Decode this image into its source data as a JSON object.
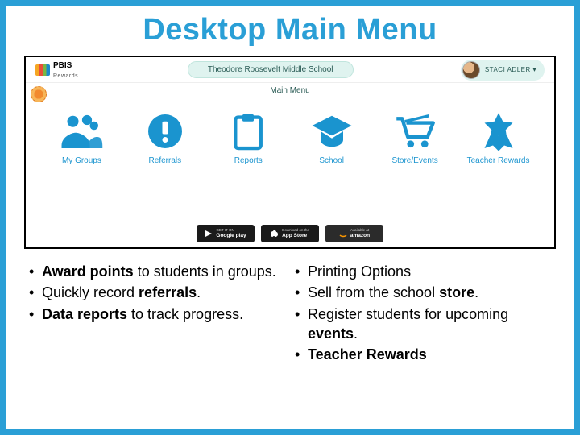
{
  "title": "Desktop Main Menu",
  "app": {
    "logo_text": "PBIS",
    "logo_sub": "Rewards.",
    "school_name": "Theodore Roosevelt Middle School",
    "user_name": "STACI ADLER ▾",
    "subhead": "Main Menu"
  },
  "tiles": [
    {
      "name": "my-groups",
      "label": "My Groups"
    },
    {
      "name": "referrals",
      "label": "Referrals"
    },
    {
      "name": "reports",
      "label": "Reports"
    },
    {
      "name": "school",
      "label": "School"
    },
    {
      "name": "store-events",
      "label": "Store/Events"
    },
    {
      "name": "teacher-rewards",
      "label": "Teacher Rewards"
    }
  ],
  "store_badges": {
    "google": {
      "line1": "GET IT ON",
      "line2": "Google play"
    },
    "apple": {
      "line1": "Download on the",
      "line2": "App Store"
    },
    "amazon": {
      "line1": "Available at",
      "line2": "amazon"
    }
  },
  "bullets_left": [
    {
      "pre_b": "Award points",
      "post": " to students in groups."
    },
    {
      "pre": "Quickly record ",
      "b": "referrals",
      "post": "."
    },
    {
      "b": "Data reports",
      "post": " to track progress."
    }
  ],
  "bullets_right": [
    {
      "post": "Printing Options"
    },
    {
      "pre": "Sell from the school ",
      "b": "store",
      "post": "."
    },
    {
      "pre": "Register students for upcoming ",
      "b": "events",
      "post": "."
    },
    {
      "b": "Teacher Rewards"
    }
  ]
}
